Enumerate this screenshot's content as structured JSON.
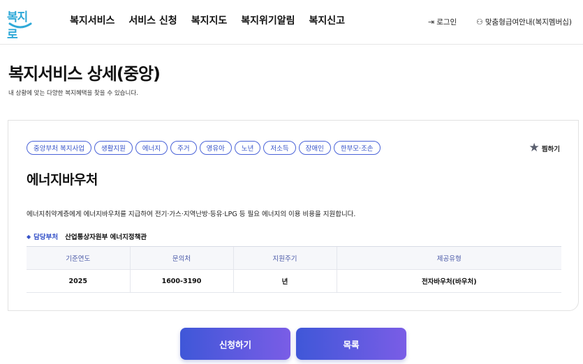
{
  "header": {
    "logo_text": "복지로",
    "nav": [
      "복지서비스",
      "서비스 신청",
      "복지지도",
      "복지위기알림",
      "복지신고"
    ],
    "login_label": "로그인",
    "member_label": "맞춤형급여안내(복지멤버십)"
  },
  "page": {
    "title": "복지서비스 상세(중앙)",
    "subtitle": "내 상황에 맞는 다양한 복지혜택을 찾을 수 있습니다."
  },
  "service": {
    "tags": [
      "중앙부처 복지사업",
      "생활지원",
      "에너지",
      "주거",
      "영유아",
      "노년",
      "저소득",
      "장애인",
      "한부모·조손"
    ],
    "favorite_label": "찜하기",
    "name": "에너지바우처",
    "description": "에너지취약계층에게 에너지바우처를 지급하여 전기·가스·지역난방·등유·LPG 등 필요 에너지의 이용 비용을 지원합니다.",
    "dept_label": "담당부처",
    "dept_value": "산업통상자원부 에너지정책관",
    "table": {
      "headers": [
        "기준연도",
        "문의처",
        "지원주기",
        "제공유형"
      ],
      "row": [
        "2025",
        "1600-3190",
        "년",
        "전자바우처(바우처)"
      ]
    }
  },
  "buttons": {
    "apply": "신청하기",
    "list": "목록"
  },
  "colors": {
    "accent": "#3f57d8",
    "accent_end": "#7a5de6",
    "tag_border": "#4a63d8"
  }
}
